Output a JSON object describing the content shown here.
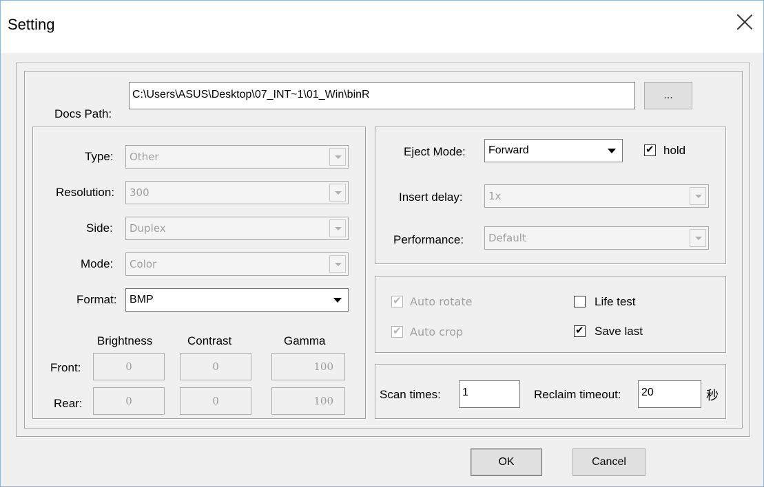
{
  "window": {
    "title": "Setting"
  },
  "docs_path": {
    "label": "Docs Path:",
    "value": "C:\\Users\\ASUS\\Desktop\\07_INT~1\\01_Win\\binR",
    "browse_label": "..."
  },
  "image": {
    "type": {
      "label": "Type:",
      "value": "Other"
    },
    "resolution": {
      "label": "Resolution:",
      "value": "300"
    },
    "side": {
      "label": "Side:",
      "value": "Duplex"
    },
    "mode": {
      "label": "Mode:",
      "value": "Color"
    },
    "format": {
      "label": "Format:",
      "value": "BMP"
    }
  },
  "adjust": {
    "headers": {
      "brightness": "Brightness",
      "contrast": "Contrast",
      "gamma": "Gamma"
    },
    "front": {
      "label": "Front:",
      "brightness": "0",
      "contrast": "0",
      "gamma": "100"
    },
    "rear": {
      "label": "Rear:",
      "brightness": "0",
      "contrast": "0",
      "gamma": "100"
    }
  },
  "eject": {
    "mode_label": "Eject Mode:",
    "mode_value": "Forward",
    "hold_label": "hold",
    "hold_checked": true,
    "insert_delay_label": "Insert delay:",
    "insert_delay_value": "1x",
    "performance_label": "Performance:",
    "performance_value": "Default"
  },
  "options": {
    "auto_rotate": "Auto rotate",
    "auto_crop": "Auto crop",
    "life_test": "Life test",
    "save_last": "Save last"
  },
  "scan": {
    "scan_times_label": "Scan times:",
    "scan_times_value": "1",
    "reclaim_label": "Reclaim timeout:",
    "reclaim_value": "20",
    "unit": "秒"
  },
  "buttons": {
    "ok": "OK",
    "cancel": "Cancel"
  }
}
